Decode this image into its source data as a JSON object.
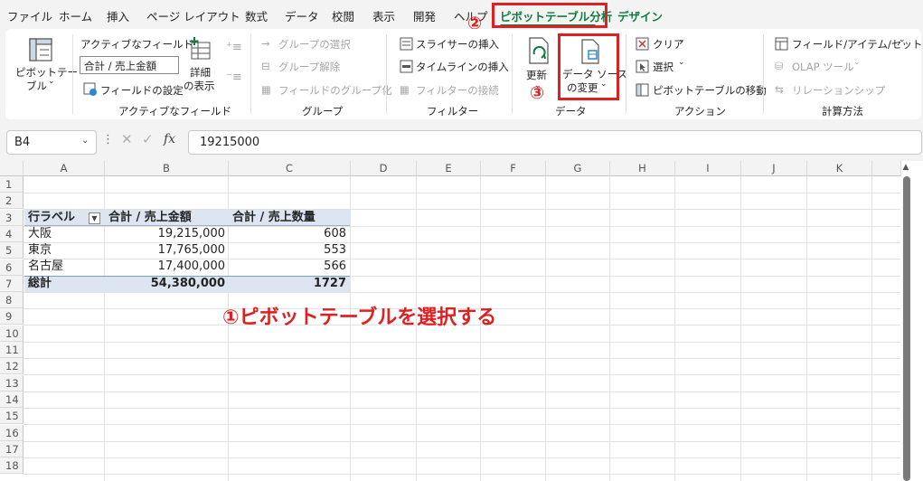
{
  "tabs": {
    "file": "ファイル",
    "home": "ホーム",
    "insert": "挿入",
    "page_layout": "ページ レイアウト",
    "formulas": "数式",
    "data": "データ",
    "review": "校閲",
    "view": "表示",
    "developer": "開発",
    "help": "ヘルプ",
    "pivot_analyze": "ピボットテーブル分析",
    "design": "デザイン"
  },
  "ribbon": {
    "pivottable": {
      "line1": "ピボットテー",
      "line2": "ブル"
    },
    "active_field": {
      "label": "アクティブなフィールド:",
      "value": "合計 / 売上金額",
      "field_settings": "フィールドの設定",
      "drill_line1": "詳細",
      "drill_line2": "の表示",
      "group_label": "アクティブなフィールド"
    },
    "group": {
      "selection": "グループの選択",
      "ungroup": "グループ解除",
      "group_field": "フィールドのグループ化",
      "group_label": "グループ"
    },
    "filter": {
      "slicer": "スライサーの挿入",
      "timeline": "タイムラインの挿入",
      "connections": "フィルターの接続",
      "group_label": "フィルター"
    },
    "data": {
      "refresh": "更新",
      "change_source_line1": "データ ソース",
      "change_source_line2": "の変更",
      "group_label": "データ"
    },
    "actions": {
      "clear": "クリア",
      "select": "選択",
      "move": "ピボットテーブルの移動",
      "group_label": "アクション"
    },
    "calculations": {
      "fields_items": "フィールド/アイテム/セット",
      "olap": "OLAP ツール",
      "relationships": "リレーションシップ",
      "group_label": "計算方法"
    }
  },
  "formula_bar": {
    "name_box": "B4",
    "formula": "19215000",
    "fx": "fx"
  },
  "columns": [
    "A",
    "B",
    "C",
    "D",
    "E",
    "F",
    "G",
    "H",
    "I",
    "J",
    "K"
  ],
  "rows": [
    "1",
    "2",
    "3",
    "4",
    "5",
    "6",
    "7",
    "8",
    "9",
    "10",
    "11",
    "12",
    "13",
    "14",
    "15",
    "16",
    "17",
    "18"
  ],
  "pivot": {
    "header_label": "行ラベル",
    "header_amount": "合計 / 売上金額",
    "header_qty": "合計 / 売上数量",
    "rows": [
      {
        "label": "大阪",
        "amount": "19,215,000",
        "qty": "608"
      },
      {
        "label": "東京",
        "amount": "17,765,000",
        "qty": "553"
      },
      {
        "label": "名古屋",
        "amount": "17,400,000",
        "qty": "566"
      }
    ],
    "total_label": "総計",
    "total_amount": "54,380,000",
    "total_qty": "1727"
  },
  "annotations": {
    "step1": "①ピボットテーブルを選択する",
    "step2": "②",
    "step3": "③"
  },
  "colors": {
    "accent_green": "#107c41",
    "annotation_red": "#e02020",
    "pivot_header": "#dde5f0"
  }
}
